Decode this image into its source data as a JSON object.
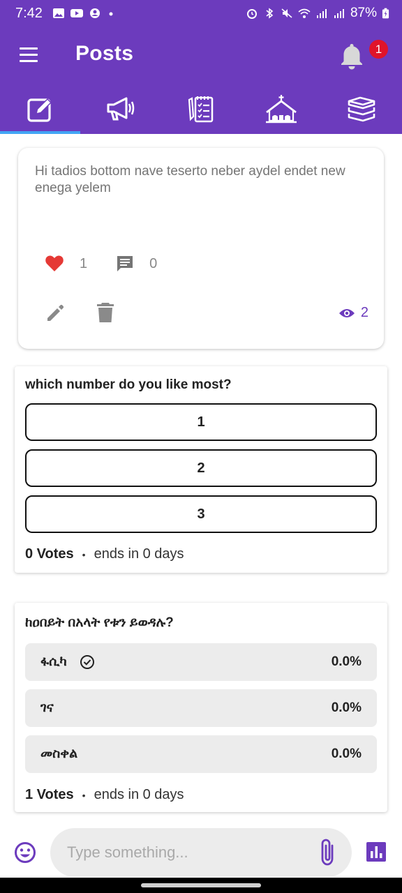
{
  "status_bar": {
    "time": "7:42",
    "battery": "87%"
  },
  "app_bar": {
    "title": "Posts",
    "notification_count": "1"
  },
  "tabs": [
    {
      "id": "posts",
      "icon": "edit-square-icon",
      "active": true
    },
    {
      "id": "announcements",
      "icon": "megaphone-icon",
      "active": false
    },
    {
      "id": "notes",
      "icon": "checklist-notepad-icon",
      "active": false
    },
    {
      "id": "church",
      "icon": "church-icon",
      "active": false
    },
    {
      "id": "library",
      "icon": "books-stack-icon",
      "active": false
    }
  ],
  "post": {
    "text": "Hi tadios bottom nave teserto neber aydel endet new enega yelem",
    "likes": "1",
    "comments": "0",
    "views": "2"
  },
  "poll1": {
    "question": "which number do you like most?",
    "options": [
      "1",
      "2",
      "3"
    ],
    "votes": "0 Votes",
    "ends": "ends in 0 days"
  },
  "poll2": {
    "question": "ከዐበይት በአላት የቱን ይወዳሉ?",
    "options": [
      {
        "label": "ፋሲካ",
        "percent": "0.0%",
        "selected": true
      },
      {
        "label": "ገና",
        "percent": "0.0%",
        "selected": false
      },
      {
        "label": "መስቀል",
        "percent": "0.0%",
        "selected": false
      }
    ],
    "votes": "1 Votes",
    "ends": "ends in 0 days"
  },
  "composer": {
    "placeholder": "Type something..."
  },
  "colors": {
    "primary": "#6c3bbd",
    "like": "#e53935",
    "badge": "#e0142a",
    "tab_indicator": "#42a5f5"
  }
}
